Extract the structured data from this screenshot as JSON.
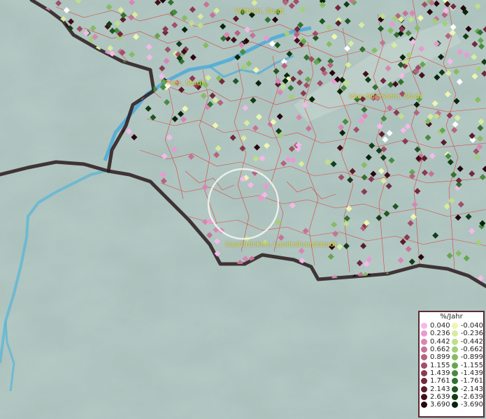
{
  "map": {
    "cities": [
      {
        "id": "wittlich",
        "name": "Wittlich, Stadt"
      },
      {
        "id": "trier",
        "name": "Trier, Stadt"
      },
      {
        "id": "idar",
        "name": "Idar-Oberstein, Stadt"
      },
      {
        "id": "saarbruecken",
        "name": "Saarbrücken, Landeshauptstadt"
      }
    ]
  },
  "legend": {
    "title": "%/Jahr",
    "positive": [
      {
        "label": "0.040",
        "color": "#f4b9e8"
      },
      {
        "label": "0.236",
        "color": "#e99ad0"
      },
      {
        "label": "0.442",
        "color": "#d886b4"
      },
      {
        "label": "0.662",
        "color": "#c67496"
      },
      {
        "label": "0.899",
        "color": "#b5637e"
      },
      {
        "label": "1.155",
        "color": "#a24f68"
      },
      {
        "label": "1.439",
        "color": "#8b3a52"
      },
      {
        "label": "1.761",
        "color": "#732a3e"
      },
      {
        "label": "2.143",
        "color": "#5c1c2b"
      },
      {
        "label": "2.639",
        "color": "#42101b"
      },
      {
        "label": "3.690",
        "color": "#28060d"
      }
    ],
    "negative": [
      {
        "label": "-0.040",
        "color": "#eef6b0"
      },
      {
        "label": "-0.236",
        "color": "#d7ec9c"
      },
      {
        "label": "-0.442",
        "color": "#bfdf8b"
      },
      {
        "label": "-0.662",
        "color": "#a3cf78"
      },
      {
        "label": "-0.899",
        "color": "#86bc63"
      },
      {
        "label": "-1.155",
        "color": "#67a550"
      },
      {
        "label": "-1.439",
        "color": "#4a8b3f"
      },
      {
        "label": "-1.761",
        "color": "#337130"
      },
      {
        "label": "-2.143",
        "color": "#205723"
      },
      {
        "label": "-2.639",
        "color": "#123d17"
      },
      {
        "label": "-3.690",
        "color": "#07250b"
      }
    ]
  }
}
